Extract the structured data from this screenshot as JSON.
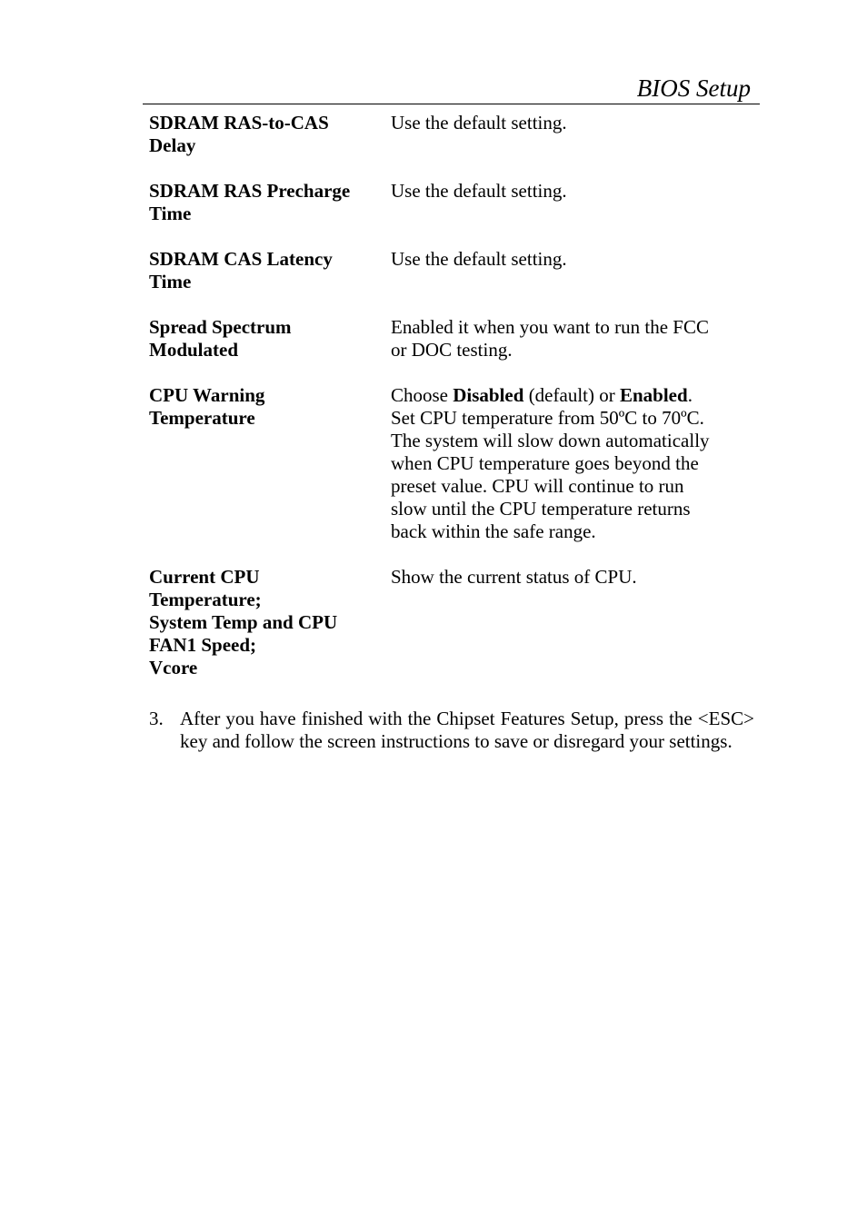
{
  "header": {
    "title": "BIOS Setup"
  },
  "rows": [
    {
      "term": "SDRAM RAS-to-CAS\nDelay",
      "desc_lines": [
        "Use the default setting."
      ]
    },
    {
      "term": "SDRAM RAS Precharge\nTime",
      "desc_lines": [
        "Use the default setting."
      ]
    },
    {
      "term": "SDRAM CAS Latency\nTime",
      "desc_lines": [
        "Use the default setting."
      ]
    },
    {
      "term": "Spread Spectrum\nModulated",
      "desc_lines": [
        "Enabled it when you want to run the FCC",
        "or DOC testing."
      ]
    },
    {
      "term": "CPU Warning\nTemperature",
      "desc_first": {
        "pre": "Choose ",
        "bold1": "Disabled",
        "mid": " (default) or ",
        "bold2": "Enabled",
        "post": "."
      },
      "desc_lines": [
        "Set CPU temperature from 50ºC to 70ºC.",
        "The system will slow down automatically",
        "when CPU temperature goes beyond the",
        "preset value.  CPU will continue to run",
        "slow until the CPU temperature returns",
        "back within the safe range."
      ]
    },
    {
      "term": "Current CPU\nTemperature;\nSystem Temp and CPU\nFAN1 Speed;\nVcore",
      "desc_lines": [
        "Show the current status of CPU."
      ]
    }
  ],
  "step": {
    "number": "3.",
    "text": "After you have finished with the Chipset Features Setup, press the <ESC> key and follow the screen instructions to save or disregard your settings."
  }
}
